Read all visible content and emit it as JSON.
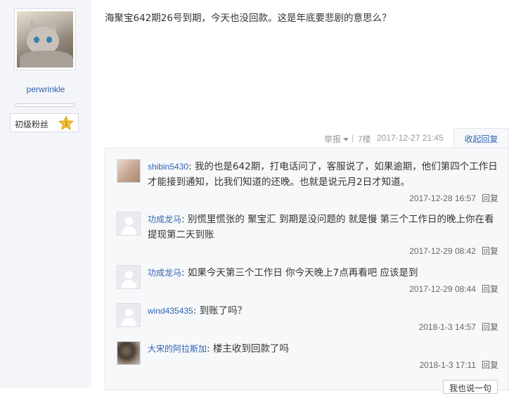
{
  "author": {
    "username": "perwrinkle",
    "level_name": "初级粉丝",
    "level_number": "1"
  },
  "post": {
    "content": "海聚宝642期26号到期，今天也没回款。这是年底要悲剧的意思么？",
    "report_label": "举报",
    "floor": "7楼",
    "time": "2017-12-27 21:45",
    "collapse_label": "收起回复"
  },
  "replies": [
    {
      "user": "shibin5430",
      "text": "我的也是642期，打电话问了，客服说了，如果逾期，他们第四个工作日才能接到通知，比我们知道的还晚。也就是说元月2日才知道。",
      "time": "2017-12-28 16:57",
      "reply_label": "回复"
    },
    {
      "user": "功成龙马",
      "text": "别慌里慌张的 聚宝汇 到期是没问题的 就是慢 第三个工作日的晚上你在看 提现第二天到账",
      "time": "2017-12-29 08:42",
      "reply_label": "回复"
    },
    {
      "user": "功成龙马",
      "text": "如果今天第三个工作日 你今天晚上7点再看吧 应该是到",
      "time": "2017-12-29 08:44",
      "reply_label": "回复"
    },
    {
      "user": "wind435435",
      "text": "到账了吗？",
      "time": "2018-1-3 14:57",
      "reply_label": "回复"
    },
    {
      "user": "大宋的阿拉斯加",
      "text": "楼主收到回款了吗",
      "time": "2018-1-3 17:11",
      "reply_label": "回复"
    }
  ],
  "say_button_label": "我也说一句",
  "colors": {
    "link": "#2d64b3",
    "meta": "#999999",
    "sidebar_bg": "#f3f5f8",
    "reply_bg": "#f7f8fa"
  }
}
